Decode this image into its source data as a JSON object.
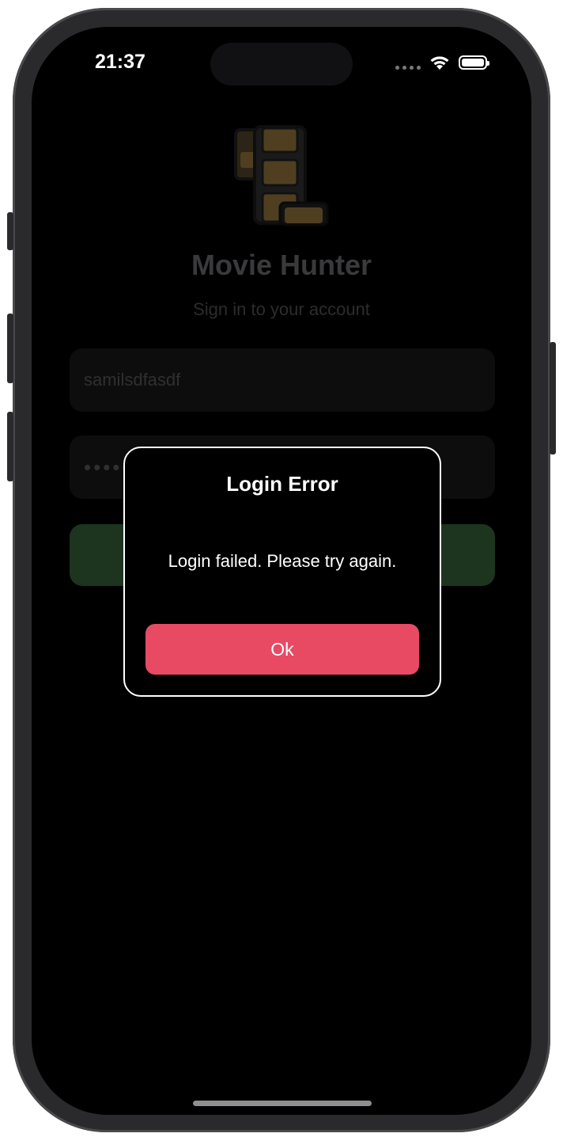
{
  "status_bar": {
    "time": "21:37"
  },
  "app": {
    "logo_icon": "film-strip-icon",
    "title": "Movie Hunter",
    "subtitle": "Sign in to your account"
  },
  "form": {
    "username_value": "samilsdfasdf",
    "password_value": "••••••••",
    "signin_color": "#1d341e"
  },
  "dialog": {
    "title": "Login Error",
    "message": "Login failed. Please try again.",
    "ok_label": "Ok",
    "ok_color": "#e84a64"
  }
}
